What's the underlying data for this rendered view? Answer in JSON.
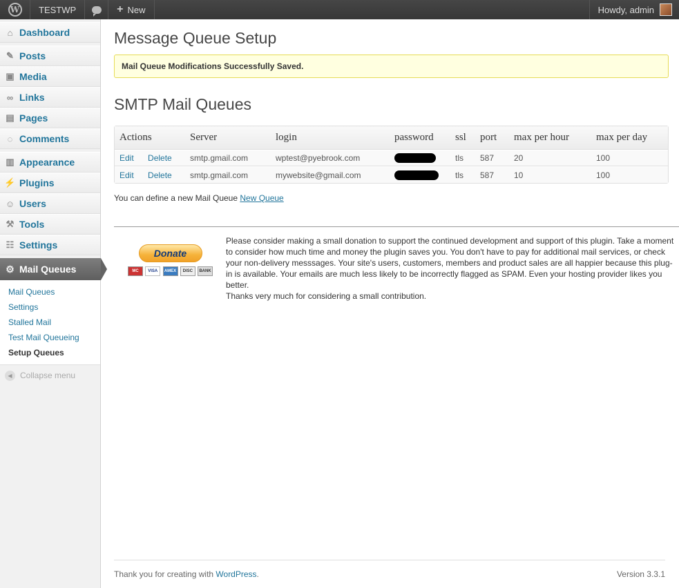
{
  "adminbar": {
    "site_name": "TESTWP",
    "new_label": "New",
    "howdy": "Howdy, admin"
  },
  "sidebar": {
    "items": [
      {
        "label": "Dashboard",
        "icon": "home-icon"
      },
      {
        "label": "Posts",
        "icon": "pin-icon"
      },
      {
        "label": "Media",
        "icon": "media-icon"
      },
      {
        "label": "Links",
        "icon": "link-icon"
      },
      {
        "label": "Pages",
        "icon": "pages-icon"
      },
      {
        "label": "Comments",
        "icon": "comment-icon"
      },
      {
        "label": "Appearance",
        "icon": "appearance-icon"
      },
      {
        "label": "Plugins",
        "icon": "plugin-icon"
      },
      {
        "label": "Users",
        "icon": "users-icon"
      },
      {
        "label": "Tools",
        "icon": "tools-icon"
      },
      {
        "label": "Settings",
        "icon": "settings-icon"
      }
    ],
    "current": "Mail Queues",
    "submenu": [
      "Mail Queues",
      "Settings",
      "Stalled Mail",
      "Test Mail Queueing",
      "Setup Queues"
    ],
    "collapse": "Collapse menu"
  },
  "main": {
    "title": "Message Queue Setup",
    "notice": "Mail Queue Modifications Successfully Saved.",
    "section_title": "SMTP Mail Queues",
    "table": {
      "headers": [
        "Actions",
        "Server",
        "login",
        "password",
        "ssl",
        "port",
        "max per hour",
        "max per day"
      ],
      "rows": [
        {
          "edit": "Edit",
          "delete": "Delete",
          "server": "smtp.gmail.com",
          "login": "wptest@pyebrook.com",
          "ssl": "tls",
          "port": "587",
          "per_hour": "20",
          "per_day": "100"
        },
        {
          "edit": "Edit",
          "delete": "Delete",
          "server": "smtp.gmail.com",
          "login": "mywebsite@gmail.com",
          "ssl": "tls",
          "port": "587",
          "per_hour": "10",
          "per_day": "100"
        }
      ]
    },
    "define_text": "You can define a new Mail Queue",
    "define_link": "New Queue",
    "donate_button": "Donate",
    "cards": [
      "MC",
      "VISA",
      "AMEX",
      "DISC",
      "BANK"
    ],
    "donate_text": "Please consider making a small donation to support the continued development and support of this plugin. Take a moment to consider how much time and money the plugin saves you. You don't have to pay for additional mail services, or check your non-delivery messsages. Your site's users, customers, members and product sales are all happier because this plug-in is available. Your emails are much less likely to be incorrectly flagged as SPAM. Even your hosting provider likes you better.",
    "thanks_text": "Thanks very much for considering a small contribution."
  },
  "footer": {
    "thanks": "Thank you for creating with ",
    "wordpress": "WordPress",
    "period": ".",
    "version": "Version 3.3.1"
  },
  "colors": {
    "link": "#21759b",
    "notice_bg": "#ffffe0",
    "notice_border": "#e6db55",
    "adminbar": "#464646"
  }
}
